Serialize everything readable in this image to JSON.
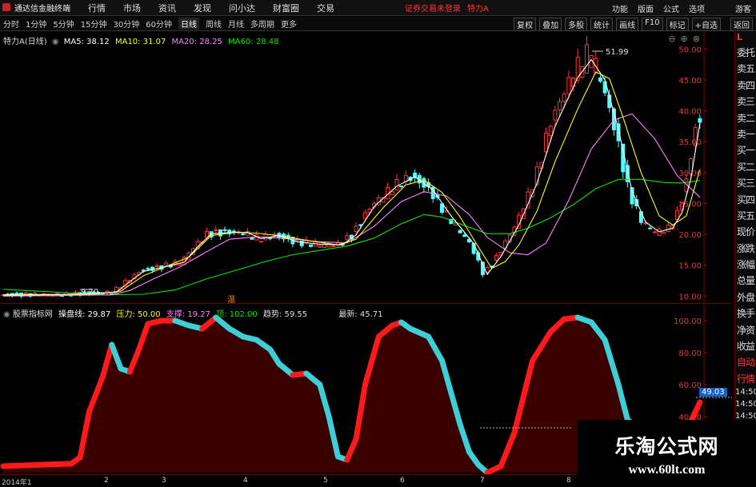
{
  "menubar": {
    "app_title": "通达信金融终端",
    "items": [
      "行情",
      "市场",
      "资讯",
      "发现",
      "问小达",
      "财富圈",
      "交易"
    ],
    "trade_status": "证券交易未登录",
    "stock_name": "特力A",
    "right_items": [
      "功能",
      "版面",
      "公式",
      "选项"
    ],
    "guest": "游客"
  },
  "periodbar": {
    "periods": [
      "分时",
      "1分钟",
      "5分钟",
      "15分钟",
      "30分钟",
      "60分钟",
      "日线",
      "周线",
      "月线",
      "多周期",
      "更多"
    ],
    "active": "日线",
    "tools": [
      "复权",
      "叠加",
      "多股",
      "统计",
      "画线",
      "F10",
      "标记",
      "+自选"
    ],
    "back": "返回"
  },
  "main_chart": {
    "title": "特力A(日线)",
    "ma5": "MA5: 38.12",
    "ma10": "MA10: 31.07",
    "ma20": "MA20: 28.25",
    "ma60": "MA60: 28.48",
    "high_label": "51.99",
    "low_label": "9.70",
    "yticks": [
      "50.00",
      "45.00",
      "40.00",
      "35.00",
      "30.00",
      "25.00",
      "20.00",
      "15.00",
      "10.00"
    ],
    "ylim": [
      9.0,
      52.5
    ],
    "marker_char": "温",
    "colors": {
      "up": "#ff3232",
      "down": "#54fcfc",
      "ma5": "#ffffff",
      "ma10": "#ffff00",
      "ma20": "#ff80ff",
      "ma60": "#00e600"
    },
    "ma5_points": [
      [
        0,
        10.2
      ],
      [
        15,
        10.3
      ],
      [
        25,
        10.6
      ],
      [
        27,
        11.8
      ],
      [
        31,
        14
      ],
      [
        35,
        14.6
      ],
      [
        40,
        15.5
      ],
      [
        43,
        18
      ],
      [
        46,
        20.1
      ],
      [
        51,
        20.3
      ],
      [
        54,
        20.3
      ],
      [
        57,
        19.3
      ],
      [
        61,
        19.8
      ],
      [
        65,
        18.8
      ],
      [
        70,
        18.4
      ],
      [
        75,
        18.3
      ],
      [
        78,
        19.9
      ],
      [
        82,
        24.5
      ],
      [
        87,
        27.8
      ],
      [
        91,
        29.3
      ],
      [
        95,
        27.2
      ],
      [
        99,
        23
      ],
      [
        104,
        18.5
      ],
      [
        107,
        13.5
      ],
      [
        110,
        16.4
      ],
      [
        114,
        21.5
      ],
      [
        118,
        28.3
      ],
      [
        122,
        37.5
      ],
      [
        127,
        45.4
      ],
      [
        130,
        48.3
      ],
      [
        133,
        45
      ],
      [
        136,
        37
      ],
      [
        139,
        27
      ],
      [
        142,
        22
      ],
      [
        145,
        20.4
      ],
      [
        148,
        21
      ],
      [
        150,
        23.5
      ],
      [
        152,
        29
      ],
      [
        154,
        38
      ]
    ],
    "ma10_points": [
      [
        0,
        10.1
      ],
      [
        20,
        10.3
      ],
      [
        26,
        10.8
      ],
      [
        31,
        13.3
      ],
      [
        36,
        14.8
      ],
      [
        41,
        16.3
      ],
      [
        46,
        19.8
      ],
      [
        51,
        20.3
      ],
      [
        56,
        20.2
      ],
      [
        62,
        19.7
      ],
      [
        68,
        18.9
      ],
      [
        74,
        18.3
      ],
      [
        78,
        19.2
      ],
      [
        84,
        24.3
      ],
      [
        89,
        28
      ],
      [
        93,
        28.8
      ],
      [
        97,
        26.8
      ],
      [
        101,
        22.8
      ],
      [
        105,
        18
      ],
      [
        108,
        14.5
      ],
      [
        111,
        15.6
      ],
      [
        114,
        18.3
      ],
      [
        118,
        23.8
      ],
      [
        122,
        31.8
      ],
      [
        127,
        40.3
      ],
      [
        131,
        46.3
      ],
      [
        134,
        45.2
      ],
      [
        137,
        39
      ],
      [
        141,
        30
      ],
      [
        145,
        23
      ],
      [
        148,
        21.5
      ],
      [
        151,
        23
      ],
      [
        154,
        30.5
      ]
    ],
    "ma20_points": [
      [
        0,
        10
      ],
      [
        24,
        10.2
      ],
      [
        28,
        10.9
      ],
      [
        33,
        12.7
      ],
      [
        39,
        14.7
      ],
      [
        45,
        17.2
      ],
      [
        50,
        19.2
      ],
      [
        56,
        19.6
      ],
      [
        63,
        19.3
      ],
      [
        70,
        18.8
      ],
      [
        76,
        18.6
      ],
      [
        82,
        21.3
      ],
      [
        88,
        25.3
      ],
      [
        93,
        26.9
      ],
      [
        98,
        26.2
      ],
      [
        103,
        23.2
      ],
      [
        107,
        19.5
      ],
      [
        112,
        17
      ],
      [
        116,
        16.7
      ],
      [
        120,
        18.6
      ],
      [
        125,
        25.5
      ],
      [
        130,
        33.8
      ],
      [
        135,
        38.5
      ],
      [
        139,
        39.5
      ],
      [
        144,
        35.5
      ],
      [
        149,
        29.5
      ],
      [
        154,
        26
      ]
    ],
    "ma60_points": [
      [
        0,
        11.1
      ],
      [
        23,
        10.2
      ],
      [
        31,
        10.3
      ],
      [
        38,
        11
      ],
      [
        45,
        12.8
      ],
      [
        52,
        14.3
      ],
      [
        58,
        15.6
      ],
      [
        64,
        16.7
      ],
      [
        70,
        17.4
      ],
      [
        76,
        18.1
      ],
      [
        82,
        19.4
      ],
      [
        88,
        21.7
      ],
      [
        93,
        23.2
      ],
      [
        97,
        22.8
      ],
      [
        102,
        21.4
      ],
      [
        107,
        20.1
      ],
      [
        112,
        20.1
      ],
      [
        116,
        21
      ],
      [
        121,
        22.7
      ],
      [
        126,
        24.8
      ],
      [
        131,
        27.4
      ],
      [
        136,
        28.9
      ],
      [
        141,
        28.9
      ],
      [
        146,
        28.4
      ],
      [
        150,
        28.3
      ],
      [
        154,
        28.7
      ]
    ]
  },
  "indicator": {
    "name": "股票指标网",
    "line1": "操盘线: 29.87",
    "pressure": "压力: 50.00",
    "support": "支撑: 19.27",
    "top": "顶: 102.00",
    "trend": "趋势: 59.55",
    "latest": "最新: 45.71",
    "badge": "49.03",
    "yticks": [
      "100.00",
      "80.00",
      "60.00",
      "40.00"
    ],
    "ylim": [
      5,
      110
    ],
    "points": [
      [
        0,
        9
      ],
      [
        9,
        10
      ],
      [
        15,
        10.5
      ],
      [
        17,
        14.5
      ],
      [
        19,
        43
      ],
      [
        22,
        65
      ],
      [
        24,
        85
      ],
      [
        26,
        70
      ],
      [
        28,
        68
      ],
      [
        30,
        82
      ],
      [
        32,
        98
      ],
      [
        35,
        100
      ],
      [
        38,
        100
      ],
      [
        41,
        97
      ],
      [
        44,
        95
      ],
      [
        47,
        102
      ],
      [
        50,
        95
      ],
      [
        53,
        90
      ],
      [
        56,
        88
      ],
      [
        59,
        82
      ],
      [
        61,
        73
      ],
      [
        64,
        66
      ],
      [
        67,
        67
      ],
      [
        70,
        60
      ],
      [
        72,
        40
      ],
      [
        74,
        15
      ],
      [
        76,
        13
      ],
      [
        78,
        26
      ],
      [
        80,
        60
      ],
      [
        83,
        90
      ],
      [
        86,
        97
      ],
      [
        88,
        99
      ],
      [
        90,
        95
      ],
      [
        94,
        90
      ],
      [
        97,
        75
      ],
      [
        99,
        55
      ],
      [
        101,
        35
      ],
      [
        103,
        18
      ],
      [
        105,
        10
      ],
      [
        107,
        5
      ],
      [
        110,
        9
      ],
      [
        113,
        30
      ],
      [
        117,
        75
      ],
      [
        121,
        93
      ],
      [
        124,
        101
      ],
      [
        127,
        102
      ],
      [
        130,
        99
      ],
      [
        133,
        88
      ],
      [
        136,
        60
      ],
      [
        138,
        38
      ],
      [
        140,
        34
      ],
      [
        143,
        33
      ],
      [
        146,
        32
      ],
      [
        149,
        32
      ],
      [
        152,
        37
      ],
      [
        154,
        49
      ]
    ],
    "colors": {
      "up": "#ff1a1a",
      "down": "#3ccfd8",
      "fill": "#3a0000"
    }
  },
  "right_panel": {
    "items": [
      "委托",
      "卖五",
      "卖四",
      "卖三",
      "卖二",
      "卖一",
      "买一",
      "买二",
      "买三",
      "买四",
      "买五",
      "现价",
      "涨跌",
      "涨幅",
      "总量",
      "外盘",
      "换手",
      "净资",
      "收益",
      "自动",
      "行情",
      "14:50",
      "14:50",
      "14:50",
      "14:50",
      "14:50",
      "14:50",
      "14:50"
    ]
  },
  "xaxis": {
    "labels": [
      "2014年1",
      "2",
      "3",
      "4",
      "5",
      "6",
      "7",
      "8"
    ]
  },
  "watermark": {
    "title": "乐淘公式网",
    "url": "www.60lt.com"
  }
}
